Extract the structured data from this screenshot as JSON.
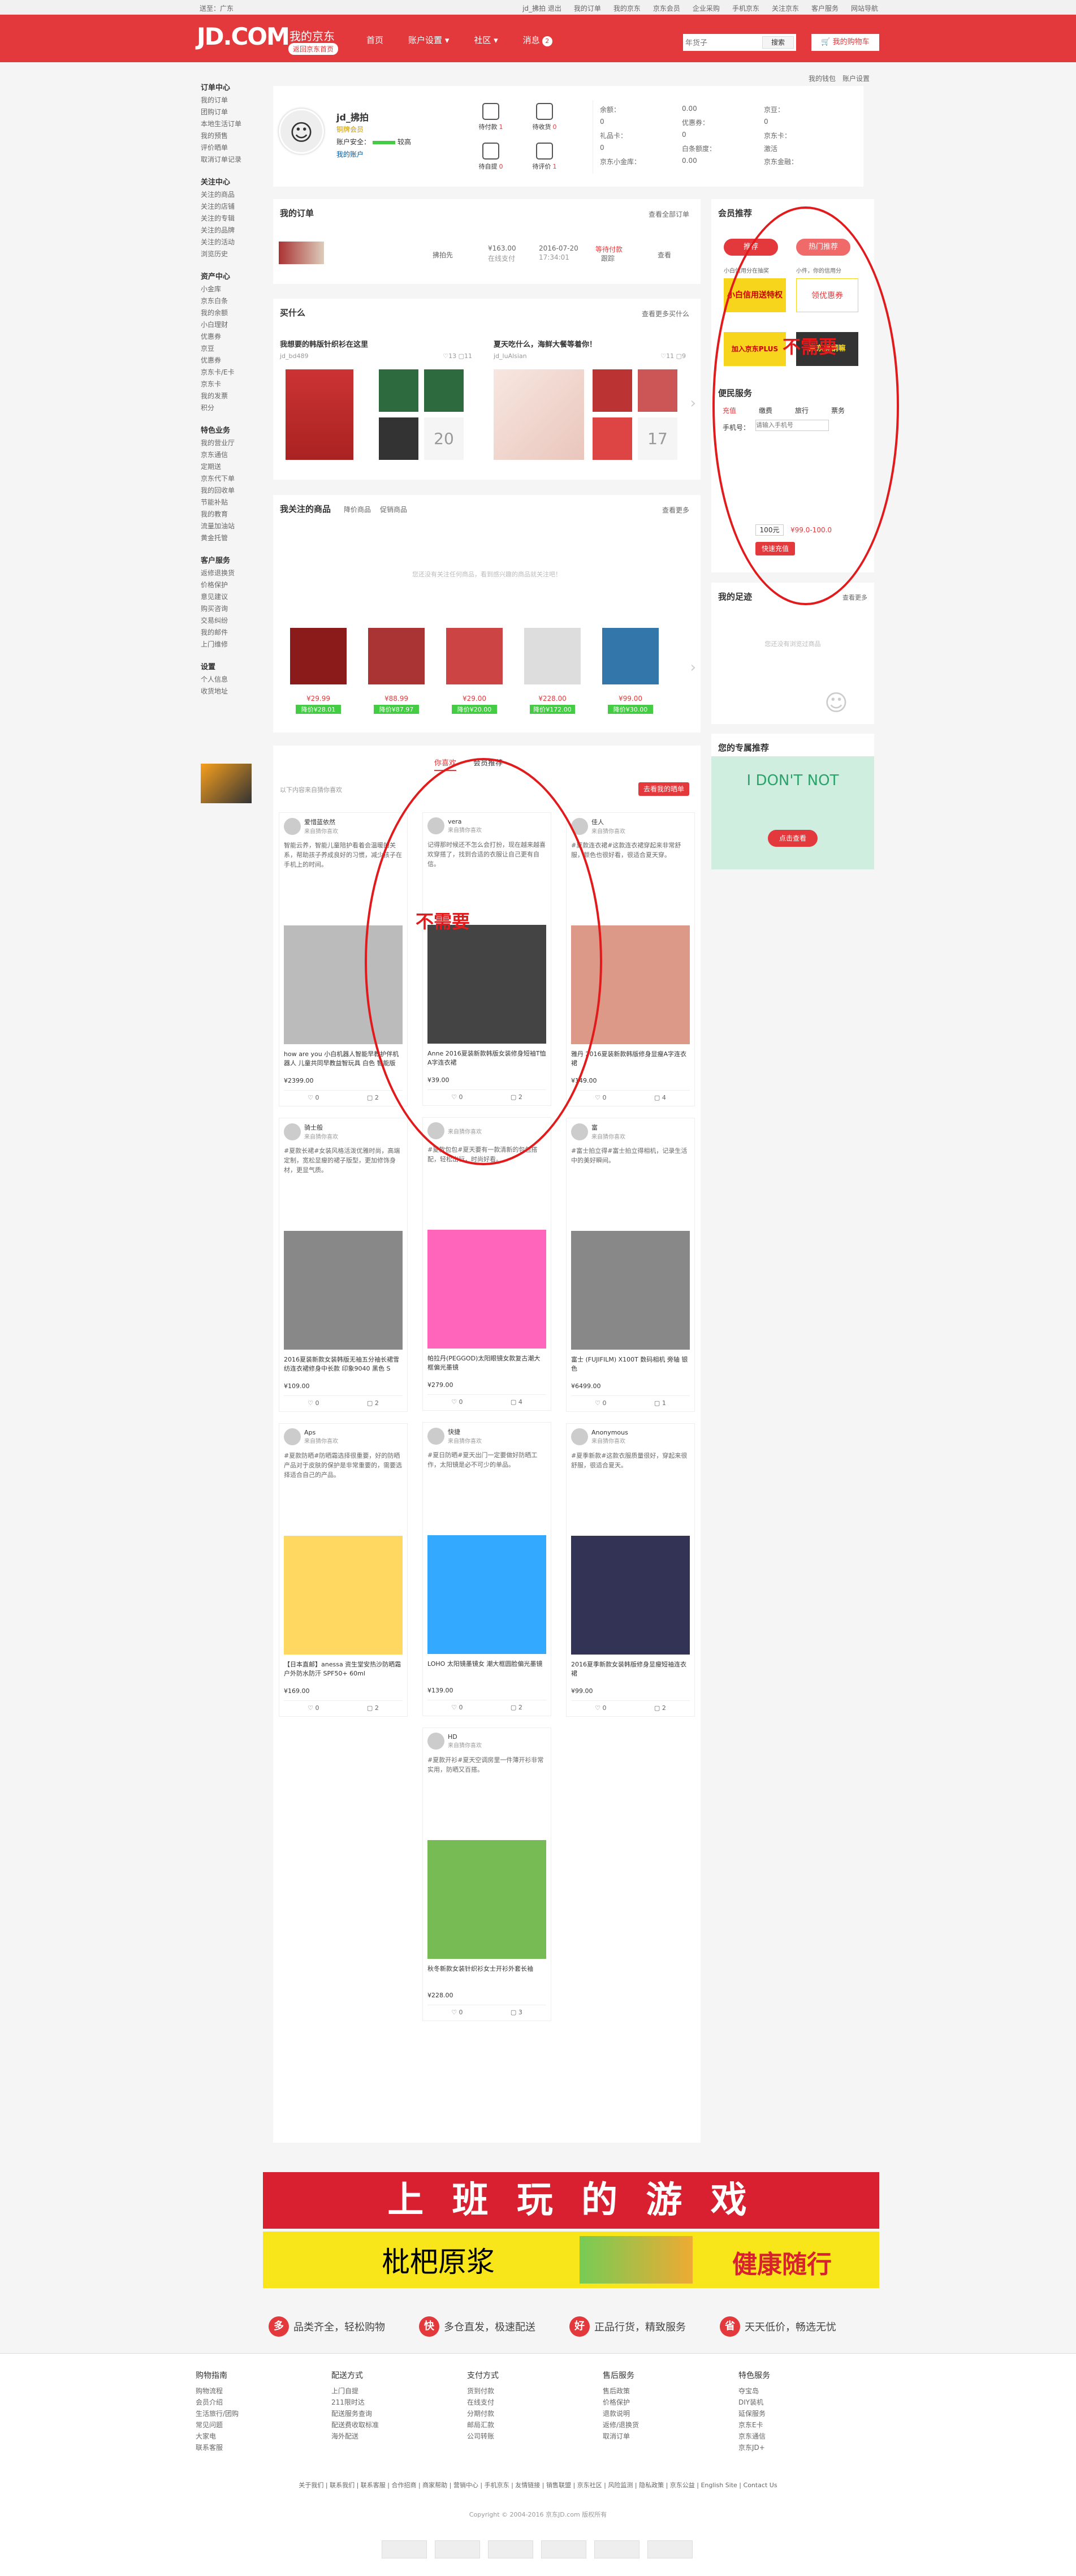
{
  "topbar": {
    "location": "送至：广东",
    "links": [
      "jd_拂拍 退出",
      "我的订单",
      "我的京东",
      "京东会员",
      "企业采购",
      "手机京东",
      "关注京东",
      "客户服务",
      "网站导航"
    ]
  },
  "header": {
    "logo": "JD.COM",
    "logo_cn": "京东",
    "my_jd": "我的京东",
    "back_home": "返回京东首页",
    "nav": [
      "首页",
      "账户设置",
      "社区",
      "消息"
    ],
    "msg_count": "2",
    "search_placeholder": "年货子",
    "search_btn": "搜索",
    "cart": "我的购物车"
  },
  "sidebar": {
    "sections": [
      {
        "title": "订单中心",
        "items": [
          "我的订单",
          "团购订单",
          "本地生活订单",
          "我的预售",
          "评价晒单",
          "取消订单记录"
        ]
      },
      {
        "title": "关注中心",
        "items": [
          "关注的商品",
          "关注的店铺",
          "关注的专辑",
          "关注的品牌",
          "关注的活动",
          "浏览历史"
        ]
      },
      {
        "title": "资产中心",
        "items": [
          "小金库",
          "京东白条",
          "我的余额",
          "小白理财",
          "优惠券",
          "京豆",
          "优惠券",
          "京东卡/E卡",
          "京东卡",
          "我的发票",
          "积分"
        ]
      },
      {
        "title": "特色业务",
        "items": [
          "我的营业厅",
          "京东通信",
          "定期送",
          "京东代下单",
          "我的回收单",
          "节能补贴",
          "我的教育",
          "流量加油站",
          "黄金托管"
        ]
      },
      {
        "title": "客户服务",
        "items": [
          "返修退换货",
          "价格保护",
          "意见建议",
          "购买咨询",
          "交易纠纷",
          "我的邮件",
          "上门维修"
        ]
      },
      {
        "title": "设置",
        "items": [
          "个人信息",
          "收货地址"
        ]
      }
    ]
  },
  "profile": {
    "username": "jd_拂拍",
    "member": "铜牌会员",
    "account_security": "账户安全：",
    "security_level": "较高",
    "my_account": "我的账户",
    "icons": [
      {
        "label": "待付款",
        "count": "1"
      },
      {
        "label": "待收货",
        "count": "0"
      },
      {
        "label": "待自提",
        "count": "0"
      },
      {
        "label": "待评价",
        "count": "1"
      }
    ],
    "assets": [
      "余额：",
      "0.00",
      "京豆：",
      "0",
      "优惠券：",
      "0",
      "礼品卡：",
      "0",
      "京东卡：",
      "0",
      "白条额度：",
      "激活",
      "京东小金库：",
      "0.00",
      "京东金融："
    ],
    "links_top": [
      "我的钱包",
      "账户设置"
    ]
  },
  "orders": {
    "title": "我的订单",
    "all": "查看全部订单",
    "row": {
      "user": "拂拍先",
      "amount": "¥163.00",
      "pay": "在线支付",
      "date": "2016-07-20",
      "time": "17:34:01",
      "status": "等待付款",
      "action": "跟踪",
      "op": "查看"
    }
  },
  "buy": {
    "title": "买什么",
    "more": "查看更多买什么",
    "items": [
      {
        "title": "我想要的韩版针织衫在这里",
        "author": "jd_bd489",
        "likes": "13",
        "comments": "11",
        "more": "20"
      },
      {
        "title": "夏天吃什么，海鲜大餐等着你！",
        "author": "jd_luAlsian",
        "likes": "11",
        "comments": "9",
        "more": "17"
      }
    ]
  },
  "follow": {
    "title": "我关注的商品",
    "tabs": [
      "降价商品",
      "促销商品"
    ],
    "more": "查看更多",
    "empty": "您还没有关注任何商品，看到感兴趣的商品就关注吧！",
    "products": [
      {
        "price": "¥29.99",
        "tag": "降价¥28.01"
      },
      {
        "price": "¥88.99",
        "tag": "降价¥87.97"
      },
      {
        "price": "¥29.00",
        "tag": "降价¥20.00"
      },
      {
        "price": "¥228.00",
        "tag": "降价¥172.00"
      },
      {
        "price": "¥99.00",
        "tag": "降价¥30.00"
      }
    ]
  },
  "feed": {
    "left_text": "以下内容来自猜你喜欢",
    "tabs": [
      "你喜欢",
      "会员推荐"
    ],
    "btn": "去看我的晒单",
    "columns": [
      [
        {
          "user": "爱惜蓝依然",
          "sub": "来自猜你喜欢",
          "text": "智能云养，智能儿童陪护看着会温暖的关系，帮助孩子养成良好的习惯，减少孩子在手机上的时间。",
          "title": "how are you 小白机器人智能早教护伴机器人 儿童共同早教益智玩具 白色 智能版",
          "price": "¥2399.00",
          "likes": "0",
          "comments": "2"
        },
        {
          "user": "骑士般",
          "sub": "来自猜你喜欢",
          "text": "#夏款长裙#女装风格活泼优雅时尚，高端定制，宽松显瘦的裙子版型，更加修饰身材，更显气质。",
          "title": "2016夏装新款女装韩版无袖五分袖长裙雪纺连衣裙修身中长款 印象9040 黑色 S",
          "price": "¥109.00",
          "likes": "0",
          "comments": "2"
        },
        {
          "user": "Aps",
          "sub": "来自猜你喜欢",
          "text": "#夏款防晒#防晒霜选择很重要，好的防晒产品对于皮肤的保护是非常重要的，需要选择适合自己的产品。",
          "title": "【日本直邮】anessa 资生堂安热沙防晒霜户外防水防汗 SPF50+ 60ml",
          "price": "¥169.00",
          "likes": "0",
          "comments": "2"
        }
      ],
      [
        {
          "user": "vera",
          "sub": "来自猜你喜欢",
          "text": "记得那时候还不怎么会打扮，现在越来越喜欢穿搭了，找到合适的衣服让自己更有自信。",
          "title": "Anne 2016夏装新款韩版女装修身短袖T恤A字连衣裙",
          "price": "¥39.00",
          "likes": "0",
          "comments": "2"
        },
        {
          "user": "",
          "sub": "来自猜你喜欢",
          "text": "#夏款包包#夏天要有一款清新的包包搭配，轻松出行，时尚好看。",
          "title": "帕拉丹(PEGGOD)太阳眼镜女款复古潮大框偏光墨镜",
          "price": "¥279.00",
          "likes": "0",
          "comments": "4"
        },
        {
          "user": "快捷",
          "sub": "来自猜你喜欢",
          "text": "#夏日防晒#夏天出门一定要做好防晒工作，太阳镜是必不可少的单品。",
          "title": "LOHO 太阳镜墨镜女 潮大框圆脸偏光墨镜",
          "price": "¥139.00",
          "likes": "0",
          "comments": "2"
        },
        {
          "user": "HD",
          "sub": "来自猜你喜欢",
          "text": "#夏款开衫#夏天空调房里一件薄开衫非常实用，防晒又百搭。",
          "title": "秋冬新款女装针织衫女士开衫外套长袖",
          "price": "¥228.00",
          "likes": "0",
          "comments": "3"
        }
      ],
      [
        {
          "user": "佳人",
          "sub": "来自猜你喜欢",
          "text": "#夏款连衣裙#这款连衣裙穿起来非常舒服，颜色也很好看，很适合夏天穿。",
          "title": "雅丹 2016夏装新款韩版修身显瘦A字连衣裙",
          "price": "¥149.00",
          "likes": "0",
          "comments": "4"
        },
        {
          "user": "富",
          "sub": "来自猜你喜欢",
          "text": "#富士拍立得#富士拍立得相机，记录生活中的美好瞬间。",
          "title": "富士 (FUJIFILM) X100T 数码相机 旁轴 银色",
          "price": "¥6499.00",
          "likes": "0",
          "comments": "1"
        },
        {
          "user": "Anonymous",
          "sub": "来自猜你喜欢",
          "text": "#夏季新款#这款衣服质量很好，穿起来很舒服，很适合夏天。",
          "title": "2016夏季新款女装韩版修身显瘦短袖连衣裙",
          "price": "¥99.00",
          "likes": "0",
          "comments": "2"
        }
      ]
    ]
  },
  "member_rec": {
    "title": "会员推荐",
    "tabs": [
      "推荐",
      "热门推荐"
    ],
    "items": [
      "小白信用送特权",
      "领优惠券",
      "加入京东PLUS",
      "京东挑钢嘛"
    ],
    "captions": [
      "小白信用分在抽奖",
      "小件，你的信用分"
    ]
  },
  "recharge": {
    "title": "便民服务",
    "tabs": [
      "充值",
      "缴费",
      "旅行",
      "票务"
    ],
    "label": "手机号：",
    "placeholder": "请输入手机号",
    "amount": "100元",
    "price": "¥99.0-100.0",
    "btn": "快速充值"
  },
  "my_footprint": {
    "title": "我的足迹",
    "more": "查看更多",
    "empty": "您还没有浏览过商品"
  },
  "exclusive": {
    "title": "您的专属推荐",
    "big": "I DON'T NOT",
    "btn": "点击查看"
  },
  "annotations": [
    "不需要",
    "不需要"
  ],
  "banner": {
    "top": "上 班 玩 的 游 戏",
    "bottom": "枇杷原浆",
    "right": "健康随行"
  },
  "guarantees": [
    {
      "icon": "多",
      "text": "品类齐全，轻松购物"
    },
    {
      "icon": "快",
      "text": "多仓直发，极速配送"
    },
    {
      "icon": "好",
      "text": "正品行货，精致服务"
    },
    {
      "icon": "省",
      "text": "天天低价，畅选无忧"
    }
  ],
  "footer_cols": [
    {
      "title": "购物指南",
      "items": [
        "购物流程",
        "会员介绍",
        "生活旅行/团购",
        "常见问题",
        "大家电",
        "联系客服"
      ]
    },
    {
      "title": "配送方式",
      "items": [
        "上门自提",
        "211限时达",
        "配送服务查询",
        "配送费收取标准",
        "海外配送"
      ]
    },
    {
      "title": "支付方式",
      "items": [
        "货到付款",
        "在线支付",
        "分期付款",
        "邮局汇款",
        "公司转账"
      ]
    },
    {
      "title": "售后服务",
      "items": [
        "售后政策",
        "价格保护",
        "退款说明",
        "返修/退换货",
        "取消订单"
      ]
    },
    {
      "title": "特色服务",
      "items": [
        "夺宝岛",
        "DIY装机",
        "延保服务",
        "京东E卡",
        "京东通信",
        "京东JD+"
      ]
    }
  ],
  "footer_links": "关于我们 | 联系我们 | 联系客服 | 合作招商 | 商家帮助 | 营销中心 | 手机京东 | 友情链接 | 销售联盟 | 京东社区 | 风险监测 | 隐私政策 | 京东公益 | English Site | Contact Us",
  "footer_copy": "Copyright © 2004-2016 京东JD.com 版权所有"
}
